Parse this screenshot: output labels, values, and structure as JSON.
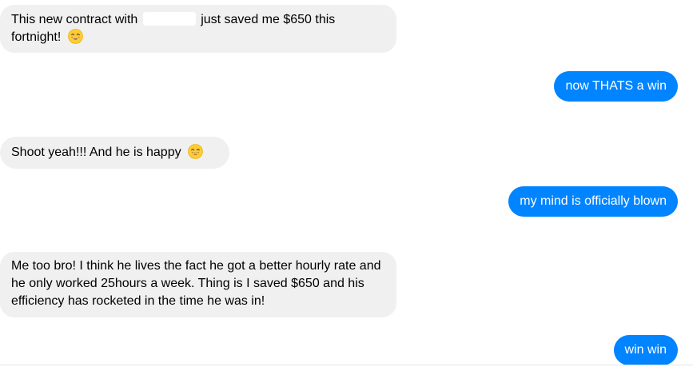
{
  "conversation": {
    "messages": [
      {
        "sender": "them",
        "text_before": "This new contract with",
        "redacted": true,
        "text_after": "just saved me $650 this fortnight!",
        "emoji": "grinning-smiling-eyes-emoji"
      },
      {
        "sender": "me",
        "text": "now THATS a win"
      },
      {
        "sender": "them",
        "text": "Shoot yeah!!! And he is happy",
        "emoji": "smiling-open-mouth-emoji"
      },
      {
        "sender": "me",
        "text": "my mind is officially blown"
      },
      {
        "sender": "them",
        "text": "Me too bro! I think he lives the fact he got a better hourly rate and he only worked 25hours a week. Thing is I saved $650 and his efficiency has rocketed in the time he was in!"
      },
      {
        "sender": "me",
        "text": "win win"
      }
    ]
  },
  "colors": {
    "incoming_bubble": "#f0f0f0",
    "outgoing_bubble": "#0084ff",
    "emoji_face": "#ffcc33",
    "emoji_feature": "#7a4b16"
  }
}
